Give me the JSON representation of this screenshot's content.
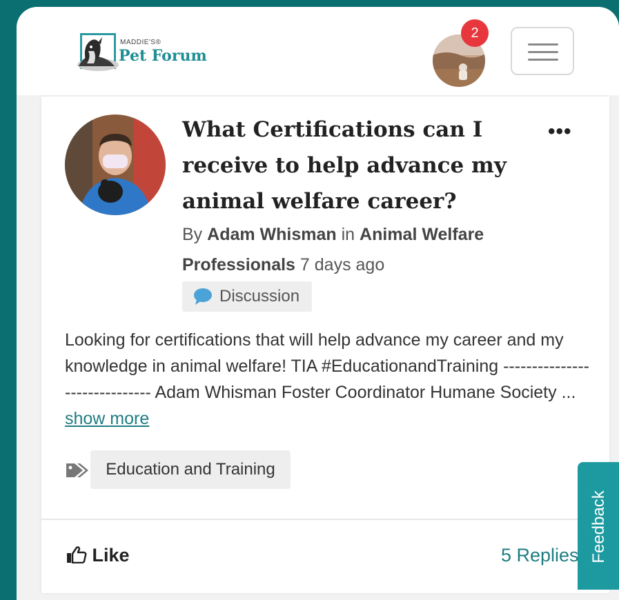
{
  "header": {
    "logo_small": "MADDIE'S®",
    "logo_main": "Pet Forum",
    "notification_count": "2",
    "menu_icon": "hamburger-icon"
  },
  "post": {
    "title": "What Certifications can I receive to help advance my animal welfare career?",
    "more_icon": "ellipsis-icon",
    "by_label": "By",
    "author": "Adam Whisman",
    "in_label": "in",
    "community": "Animal Welfare Professionals",
    "time": "7 days ago",
    "type_badge": "Discussion",
    "body": "Looking for certifications that will help advance my career and my knowledge in animal welfare! TIA #EducationandTraining ------------------------------ Adam Whisman Foster Coordinator Humane Society ...",
    "show_more": "show more",
    "tag": "Education and Training"
  },
  "actions": {
    "like": "Like",
    "replies": "5 Replies"
  },
  "feedback_tab": "Feedback",
  "colors": {
    "background": "#0b6f71",
    "brand": "#1f8e95",
    "badge": "#e7373c",
    "link": "#1f7d82",
    "feedback": "#1d9aa0"
  }
}
